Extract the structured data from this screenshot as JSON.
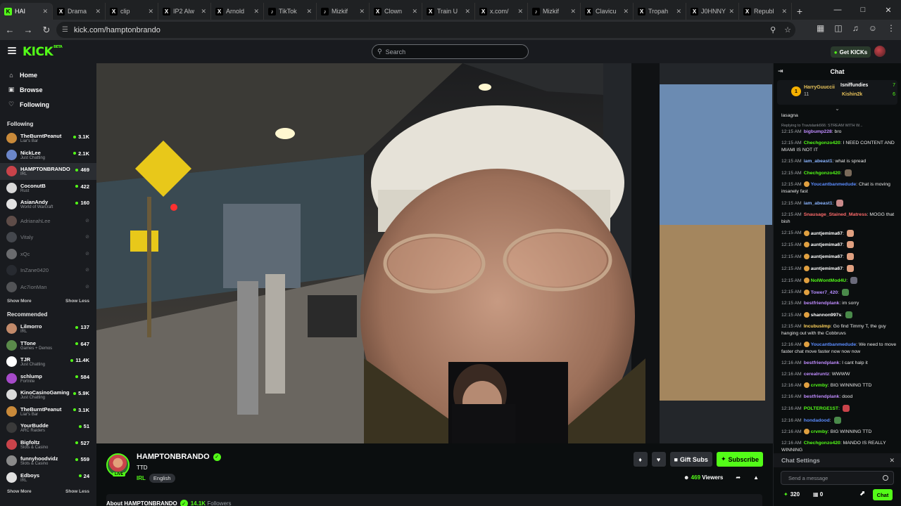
{
  "browser": {
    "tabs": [
      {
        "label": "HAI",
        "icon": "kick",
        "color": "#53fc18",
        "active": true
      },
      {
        "label": "Drama",
        "icon": "x",
        "color": "#ffffff"
      },
      {
        "label": "clip",
        "icon": "x",
        "color": "#ffffff"
      },
      {
        "label": "IP2 Alw",
        "icon": "x",
        "color": "#ffffff"
      },
      {
        "label": "Arnold",
        "icon": "x",
        "color": "#ffffff"
      },
      {
        "label": "TikTok",
        "icon": "tiktok",
        "color": "#ffffff"
      },
      {
        "label": "Mizkif",
        "icon": "tiktok",
        "color": "#ffffff"
      },
      {
        "label": "Clown",
        "icon": "x",
        "color": "#ffffff"
      },
      {
        "label": "Train U",
        "icon": "x",
        "color": "#ffffff"
      },
      {
        "label": "x.com/",
        "icon": "x",
        "color": "#ffffff"
      },
      {
        "label": "Mizkif",
        "icon": "tiktok",
        "color": "#ffffff"
      },
      {
        "label": "Clavicu",
        "icon": "x",
        "color": "#ffffff"
      },
      {
        "label": "Tropah",
        "icon": "x",
        "color": "#ffffff"
      },
      {
        "label": "J0HNNY",
        "icon": "x",
        "color": "#ffffff"
      },
      {
        "label": "Republ",
        "icon": "x",
        "color": "#ffffff"
      }
    ],
    "url": "kick.com/hamptonbrando"
  },
  "header": {
    "search_placeholder": "Search",
    "get_kicks": "Get KICKs",
    "logo": "KICK",
    "logo_badge": "BETA"
  },
  "sidebar": {
    "nav": [
      {
        "label": "Home",
        "icon": "home-icon"
      },
      {
        "label": "Browse",
        "icon": "browse-icon"
      },
      {
        "label": "Following",
        "icon": "heart-icon"
      }
    ],
    "following_title": "Following",
    "following": [
      {
        "name": "TheBurntPeanut",
        "category": "Liar's Bar",
        "viewers": "3.1K",
        "color": "#c98a3a"
      },
      {
        "name": "NickLee",
        "category": "Just Chatting",
        "viewers": "2.1K",
        "color": "#6b86c9"
      },
      {
        "name": "HAMPTONBRANDO",
        "category": "IRL",
        "viewers": "469",
        "color": "#c9434a",
        "selected": true
      },
      {
        "name": "CoconutB",
        "category": "Rust",
        "viewers": "422",
        "color": "#d8d8d8"
      },
      {
        "name": "AsianAndy",
        "category": "World of Warcraft",
        "viewers": "160",
        "color": "#e2e2e2"
      },
      {
        "name": "AdrianahLee",
        "offline": true,
        "color": "#b48a7a"
      },
      {
        "name": "Vitaly",
        "offline": true,
        "color": "#7a7f85"
      },
      {
        "name": "xQc",
        "offline": true,
        "color": "#cfcfcf"
      },
      {
        "name": "InZane0420",
        "offline": true,
        "color": "#3a3f45"
      },
      {
        "name": "Ac7ionMan",
        "offline": true,
        "color": "#9a9a9a"
      }
    ],
    "show_more": "Show More",
    "show_less": "Show Less",
    "recommended_title": "Recommended",
    "recommended": [
      {
        "name": "Lilmorro",
        "category": "IRL",
        "viewers": "137",
        "color": "#c28a6a"
      },
      {
        "name": "TTone",
        "category": "Games + Demos",
        "viewers": "647",
        "color": "#5a8a4a"
      },
      {
        "name": "TJR",
        "category": "Just Chatting",
        "viewers": "11.4K",
        "color": "#ffffff"
      },
      {
        "name": "schlump",
        "category": "Fortnite",
        "viewers": "584",
        "color": "#a64ac9"
      },
      {
        "name": "KinoCasinoGaming",
        "category": "Just Chatting",
        "viewers": "5.9K",
        "color": "#dadada"
      },
      {
        "name": "TheBurntPeanut",
        "category": "Liar's Bar",
        "viewers": "3.1K",
        "color": "#c98a3a"
      },
      {
        "name": "YourBudde",
        "category": "ARC Raiders",
        "viewers": "51",
        "color": "#3a3a3a"
      },
      {
        "name": "Bigfoltz",
        "category": "Slots & Casino",
        "viewers": "527",
        "color": "#c9434a"
      },
      {
        "name": "funnyhoodvidz",
        "category": "Slots & Casino",
        "viewers": "559",
        "color": "#8a8a8a"
      },
      {
        "name": "Edboys",
        "category": "IRL",
        "viewers": "24",
        "color": "#e0e0e0"
      }
    ]
  },
  "channel": {
    "name": "HAMPTONBRANDO",
    "title": "TTD",
    "category": "IRL",
    "language": "English",
    "live_badge": "LIVE",
    "gift_subs": "Gift Subs",
    "subscribe": "Subscribe",
    "viewers_count": "469",
    "viewers_label": "Viewers",
    "about_label": "About HAMPTONBRANDO",
    "followers_count": "14.1K",
    "followers_label": "Followers"
  },
  "chat": {
    "title": "Chat",
    "leaderboard": {
      "first": "HarryGuuccii",
      "first_count": "11",
      "second": "Isniffundies",
      "second_count": "7",
      "third": "Kishin2k",
      "third_count": "6",
      "first_rank": "1"
    },
    "partial_top": "lasagna",
    "messages": [
      {
        "reply": "Replying to Travislank666: STREAM WITH W...",
        "time": "12:15 AM",
        "user": "bigbump228",
        "color": "#c08cff",
        "text": "bro"
      },
      {
        "time": "12:15 AM",
        "user": "Chechgonzo420",
        "color": "#53fc18",
        "text": "I NEED CONTENT AND MIAMI IS NOT IT"
      },
      {
        "time": "12:15 AM",
        "user": "iam_abeast1",
        "color": "#8ab4ff",
        "text": "what is spread"
      },
      {
        "time": "12:15 AM",
        "user": "Chechgonzo420",
        "color": "#53fc18",
        "text": "",
        "emote": "#7a6a5a"
      },
      {
        "time": "12:15 AM",
        "user": "Youcantbanmedude",
        "color": "#5b8cff",
        "badge": "#e0a040",
        "text": "Chat is moving insanely fast"
      },
      {
        "time": "12:15 AM",
        "user": "iam_abeast1",
        "color": "#8ab4ff",
        "text": "",
        "emote": "#c98a8a"
      },
      {
        "time": "12:15 AM",
        "user": "Snausage_Stained_Matress",
        "color": "#ff6b6b",
        "text": "MOGG that bish"
      },
      {
        "time": "12:15 AM",
        "user": "auntjemima67",
        "color": "#ffffff",
        "badge": "#e0a040",
        "text": "",
        "emote": "#e0a080"
      },
      {
        "time": "12:15 AM",
        "user": "auntjemima67",
        "color": "#ffffff",
        "badge": "#e0a040",
        "text": "",
        "emote": "#e0a080"
      },
      {
        "time": "12:15 AM",
        "user": "auntjemima67",
        "color": "#ffffff",
        "badge": "#e0a040",
        "text": "",
        "emote": "#e0a080"
      },
      {
        "time": "12:15 AM",
        "user": "auntjemima67",
        "color": "#ffffff",
        "badge": "#e0a040",
        "text": "",
        "emote": "#e0a080"
      },
      {
        "time": "12:15 AM",
        "user": "NoIWontMod4U",
        "color": "#53fc18",
        "badge": "#e0a040",
        "text": "",
        "emote": "#6a6a7a"
      },
      {
        "time": "12:15 AM",
        "user": "Tower7_420",
        "color": "#b48cff",
        "badge": "#e0a040",
        "text": "",
        "emote": "#4a8a4a"
      },
      {
        "time": "12:15 AM",
        "user": "bestfriendplank",
        "color": "#c08cff",
        "text": "im sorry"
      },
      {
        "time": "12:15 AM",
        "user": "shannon997s",
        "color": "#ffffff",
        "badge": "#e0a040",
        "text": "",
        "emote": "#4a8a4a"
      },
      {
        "time": "12:15 AM",
        "user": "IncubusImp",
        "color": "#ffd35b",
        "text": "Go find Timmy T, the guy hanging out with the Cobbruvs"
      },
      {
        "time": "12:16 AM",
        "user": "Youcantbanmedude",
        "color": "#5b8cff",
        "badge": "#e0a040",
        "text": "We need to move faster chat move faster now now now"
      },
      {
        "time": "12:16 AM",
        "user": "bestfriendplank",
        "color": "#c08cff",
        "text": "I cant halp it"
      },
      {
        "time": "12:16 AM",
        "user": "cerealruntz",
        "color": "#c08cff",
        "text": "WWWW"
      },
      {
        "time": "12:16 AM",
        "user": "crvmby",
        "color": "#53fc18",
        "badge": "#e0a040",
        "text": "BIG WINNING TTD"
      },
      {
        "time": "12:16 AM",
        "user": "bestfriendplank",
        "color": "#c08cff",
        "text": "dood"
      },
      {
        "time": "12:16 AM",
        "user": "POLTERGE1ST",
        "color": "#53fc18",
        "text": "",
        "emote": "#c9434a"
      },
      {
        "time": "12:16 AM",
        "user": "hondadood",
        "color": "#5b8cff",
        "text": "",
        "emote": "#4a8a4a"
      },
      {
        "time": "12:16 AM",
        "user": "crvmby",
        "color": "#53fc18",
        "badge": "#e0a040",
        "text": "BIG WINNING TTD"
      },
      {
        "time": "12:16 AM",
        "user": "Chechgonzo420",
        "color": "#53fc18",
        "text": "MANDO IS REALLY WINNING"
      }
    ],
    "settings_label": "Chat Settings",
    "input_placeholder": "Send a message",
    "points": "320",
    "drops": "0",
    "send_label": "Chat"
  },
  "colors": {
    "accent": "#53fc18",
    "background": "#0b0e0f",
    "panel": "#191b1f"
  }
}
